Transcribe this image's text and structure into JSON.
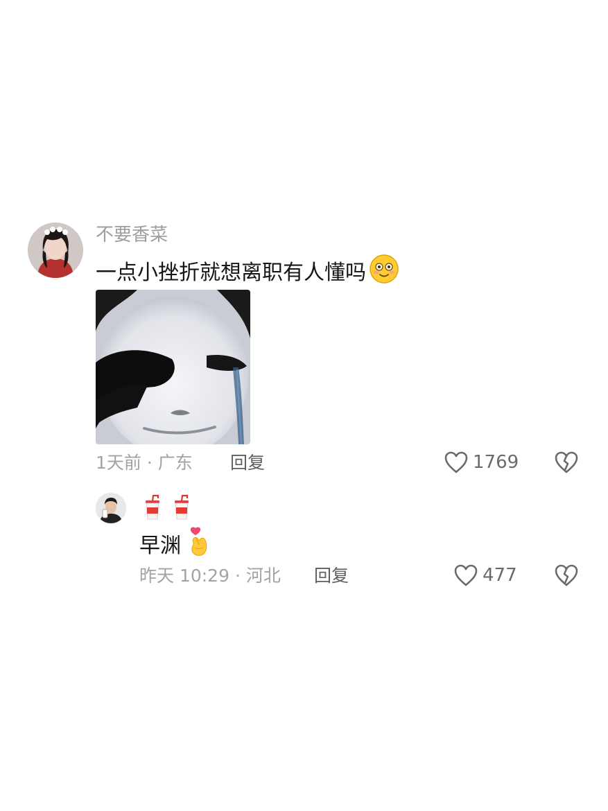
{
  "comment": {
    "avatar_icon": "user-avatar-icon",
    "username": "不要香菜",
    "text": "一点小挫折就想离职有人懂吗",
    "text_emoji": "smiling-face-emoji",
    "attachment": "crying-panda-meme-sticker",
    "meta": "1天前 · 广东",
    "reply_label": "回复",
    "like_count": "1769",
    "like_icon": "heart-outline-icon",
    "dislike_icon": "broken-heart-icon"
  },
  "reply": {
    "avatar_icon": "user-avatar-icon",
    "username_emojis": [
      "drink-cup-emoji",
      "drink-cup-emoji"
    ],
    "text": "早渊",
    "text_emoji": "finger-heart-emoji",
    "meta": "昨天 10:29 · 河北",
    "reply_label": "回复",
    "like_count": "477",
    "like_icon": "heart-outline-icon",
    "dislike_icon": "broken-heart-icon"
  }
}
